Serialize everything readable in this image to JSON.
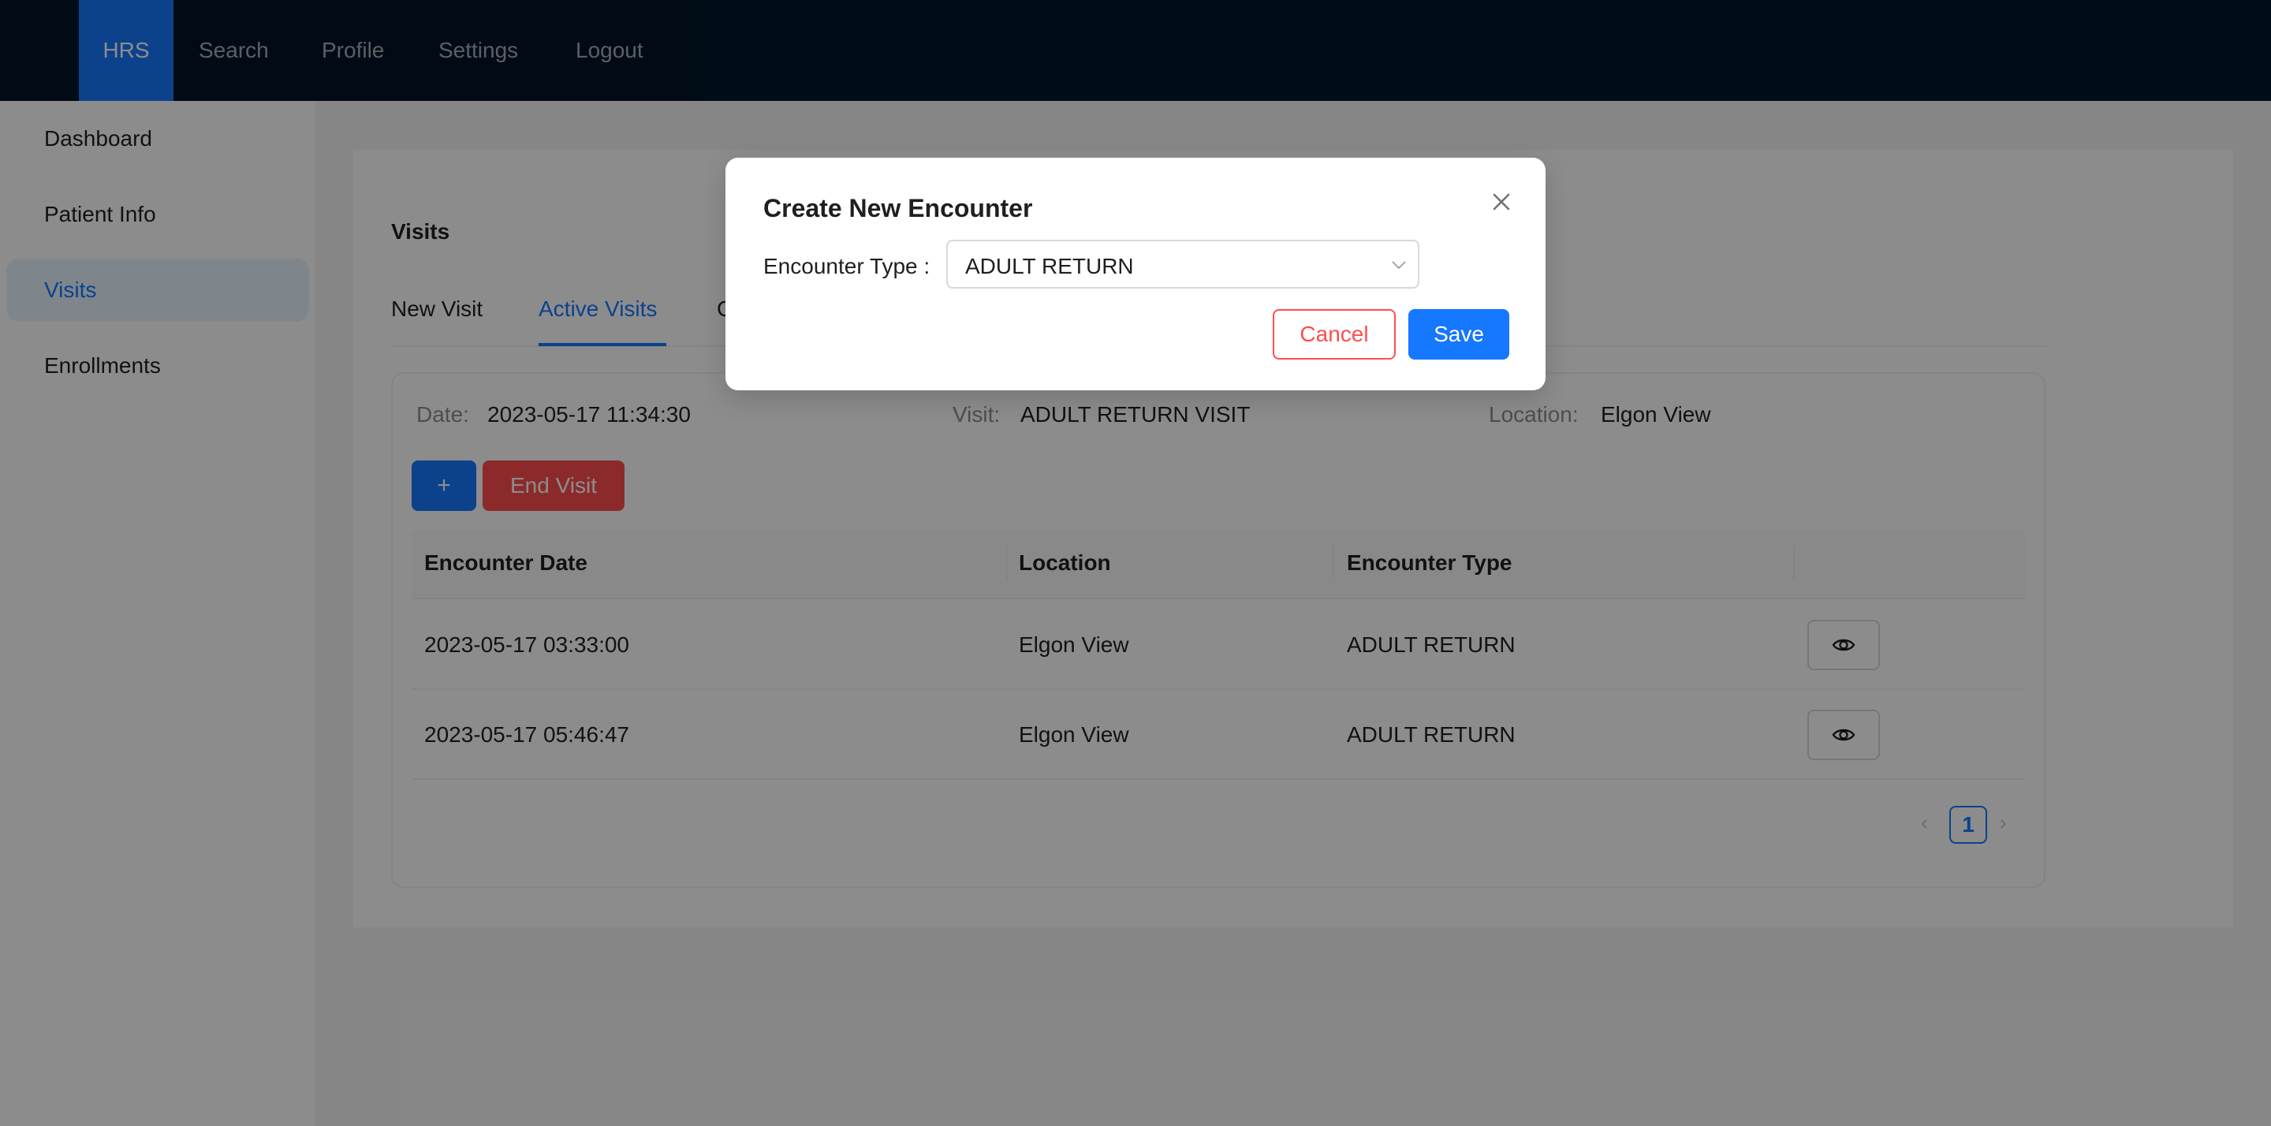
{
  "nav": {
    "items": [
      {
        "label": "HRS",
        "active": true
      },
      {
        "label": "Search"
      },
      {
        "label": "Profile"
      },
      {
        "label": "Settings"
      },
      {
        "label": "Logout"
      }
    ]
  },
  "sidebar": {
    "items": [
      {
        "label": "Dashboard"
      },
      {
        "label": "Patient Info"
      },
      {
        "label": "Visits",
        "active": true
      },
      {
        "label": "Enrollments"
      }
    ]
  },
  "page": {
    "title": "Visits",
    "tabs": [
      {
        "label": "New Visit"
      },
      {
        "label": "Active Visits",
        "active": true
      },
      {
        "label": "C"
      }
    ]
  },
  "visit": {
    "date_label": "Date",
    "date_value": "2023-05-17 11:34:30",
    "visit_label": "Visit",
    "visit_value": "ADULT RETURN VISIT",
    "location_label": "Location",
    "location_value": "Elgon View",
    "add_label": "+",
    "end_label": "End Visit"
  },
  "table": {
    "columns": [
      "Encounter Date",
      "Location",
      "Encounter Type",
      ""
    ],
    "rows": [
      {
        "date": "2023-05-17 03:33:00",
        "location": "Elgon View",
        "type": "ADULT RETURN",
        "action_icon": "eye-icon"
      },
      {
        "date": "2023-05-17 05:46:47",
        "location": "Elgon View",
        "type": "ADULT RETURN",
        "action_icon": "eye-icon"
      }
    ]
  },
  "pagination": {
    "current": "1",
    "prev_icon": "chevron-left-icon",
    "next_icon": "chevron-right-icon"
  },
  "modal": {
    "title": "Create New Encounter",
    "field_label": "Encounter Type :",
    "selected_value": "ADULT RETURN",
    "cancel_label": "Cancel",
    "save_label": "Save"
  },
  "colors": {
    "nav_bg": "#001529",
    "primary": "#1677ff",
    "danger": "#ff4d4f",
    "sidebar_active_bg": "#e6f4ff"
  }
}
